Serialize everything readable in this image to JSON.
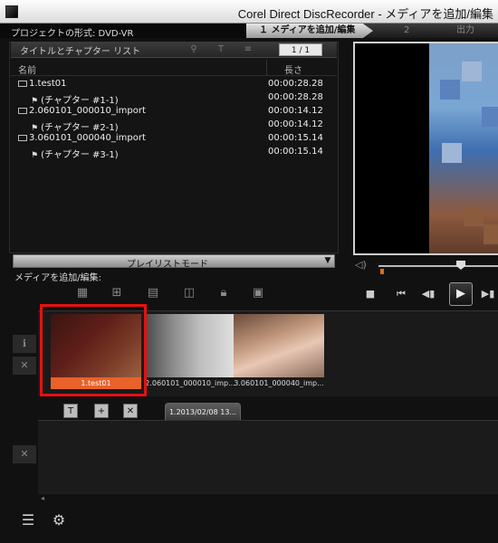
{
  "window": {
    "title": "Corel Direct DiscRecorder - メディアを追加/編集"
  },
  "project": {
    "format_label": "プロジェクトの形式: DVD-VR"
  },
  "steps": [
    {
      "label": "１ メディアを追加/編集"
    },
    {
      "label": "2"
    },
    {
      "label": "出力"
    }
  ],
  "list": {
    "title": "タイトルとチャプター リスト",
    "page": "1 / 1",
    "col_name": "名前",
    "col_length": "長さ",
    "rows": [
      {
        "name": "1.test01",
        "duration": "00:00:28.28",
        "kind": "title"
      },
      {
        "name": "(チャプター #1-1)",
        "duration": "00:00:28.28",
        "kind": "chapter"
      },
      {
        "name": "2.060101_000010_import",
        "duration": "00:00:14.12",
        "kind": "title"
      },
      {
        "name": "(チャプター #2-1)",
        "duration": "00:00:14.12",
        "kind": "chapter"
      },
      {
        "name": "3.060101_000040_import",
        "duration": "00:00:15.14",
        "kind": "title"
      },
      {
        "name": "(チャプター #3-1)",
        "duration": "00:00:15.14",
        "kind": "chapter"
      }
    ]
  },
  "playlist": {
    "mode_label": "プレイリストモード",
    "media_label": "メディアを追加/編集:"
  },
  "timeline": {
    "clips": [
      {
        "caption": "1.test01",
        "selected": true
      },
      {
        "caption": "2.060101_000010_imp...",
        "selected": false
      },
      {
        "caption": "3.060101_000040_imp...",
        "selected": false
      }
    ],
    "tab_label": "1.2013/02/08 13..."
  },
  "colors": {
    "accent_selected": "#e81010",
    "caption_selected_bg": "#e8622a"
  }
}
